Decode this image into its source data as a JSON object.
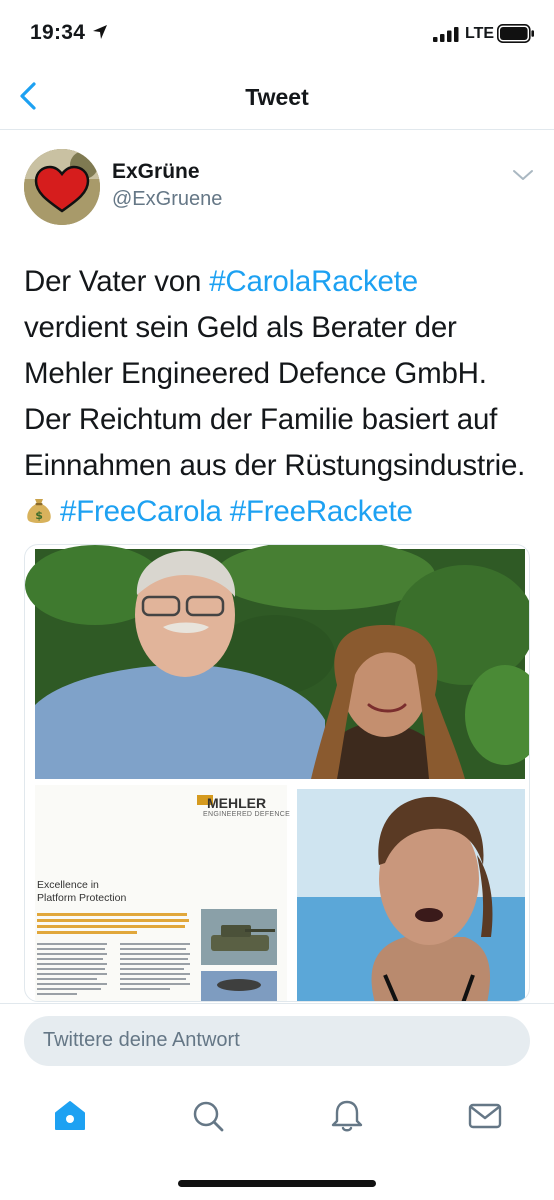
{
  "status_bar": {
    "time": "19:34",
    "network": "LTE"
  },
  "nav": {
    "title": "Tweet",
    "back_icon": "chevron-left-icon"
  },
  "tweet": {
    "author_name": "ExGrüne",
    "author_handle": "@ExGruene",
    "text_lines": [
      [
        "Der Vater von ",
        "#CarolaRackete"
      ],
      [
        "verdient sein Geld als Berater der"
      ],
      [
        "Mehler Engineered Defence GmbH."
      ],
      [
        "Der Reichtum der Familie basiert auf"
      ],
      [
        "Einnahmen aus der Rüstungsindustrie."
      ]
    ],
    "line1_plain": "Der Vater von ",
    "line1_tag": "#CarolaRackete",
    "line2": "verdient sein Geld als Berater der",
    "line3": "Mehler Engineered Defence GmbH.",
    "line4": "Der Reichtum der Familie basiert auf",
    "line5": "Einnahmen aus der Rüstungsindustrie.",
    "emoji": "money-bag-icon",
    "tag2": "#FreeCarola",
    "tag3": "#FreeRackete"
  },
  "media": {
    "brochure_logo": "MEHLER",
    "brochure_logo_sub": "ENGINEERED DEFENCE",
    "brochure_heading_1": "Excellence in",
    "brochure_heading_2": "Platform Protection"
  },
  "reply": {
    "placeholder": "Twittere deine Antwort"
  },
  "tabs": [
    {
      "icon": "home-icon",
      "active": true
    },
    {
      "icon": "search-icon",
      "active": false
    },
    {
      "icon": "notifications-bell-icon",
      "active": false
    },
    {
      "icon": "messages-envelope-icon",
      "active": false
    }
  ],
  "colors": {
    "accent": "#1da1f2",
    "text": "#14171a",
    "secondary": "#657786",
    "divider": "#e1e8ed",
    "reply_bg": "#e6ecf0"
  }
}
